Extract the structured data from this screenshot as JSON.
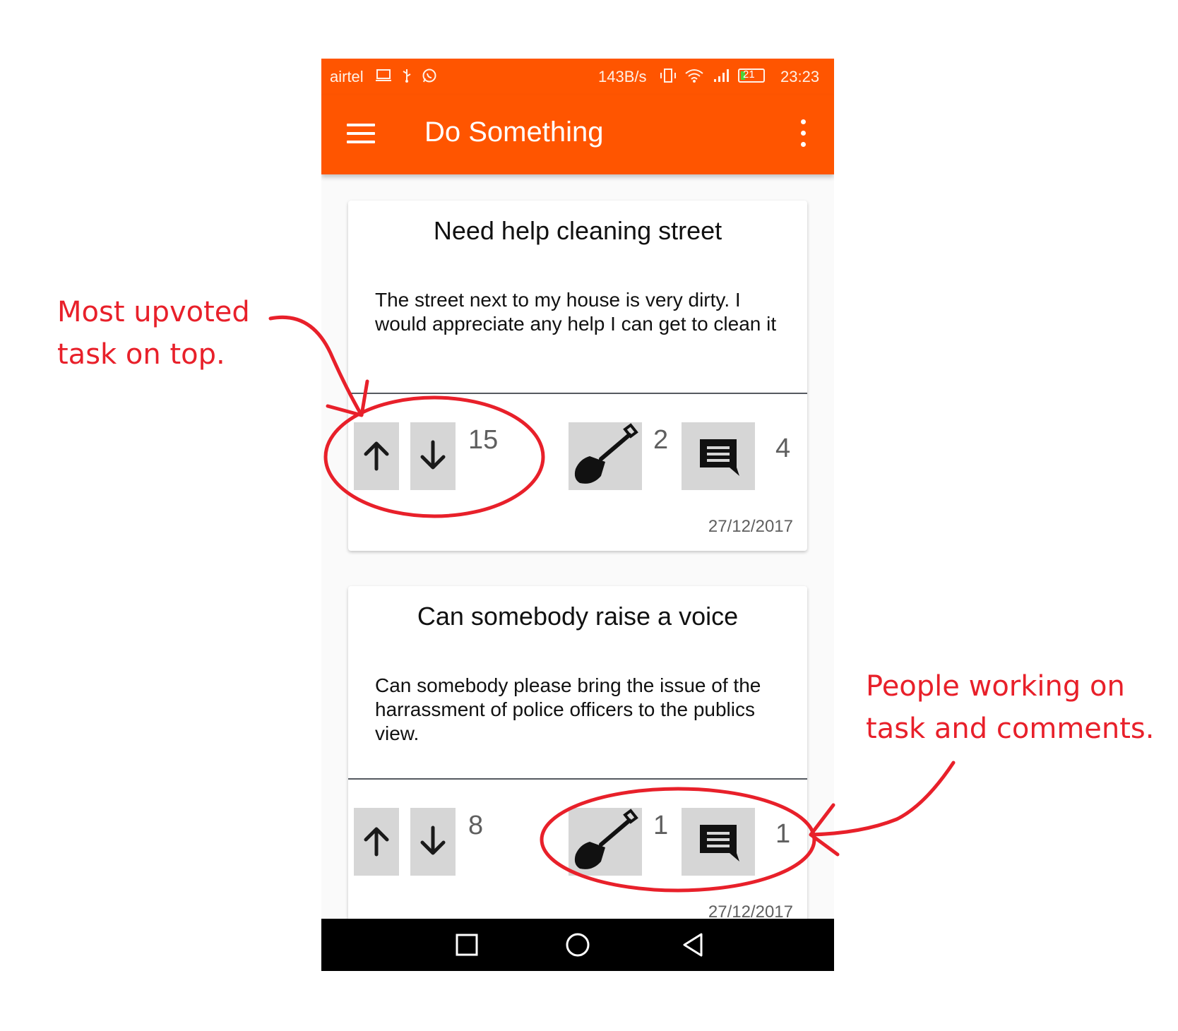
{
  "status_bar": {
    "carrier": "airtel",
    "left_icons": [
      "laptop-icon",
      "usb-icon",
      "whatsapp-icon"
    ],
    "speed": "143B/s",
    "right_icons": [
      "vibrate-icon",
      "wifi-icon",
      "signal-icon"
    ],
    "battery": 21,
    "battery_label": "21",
    "time": "23:23"
  },
  "app_bar": {
    "title": "Do Something",
    "left_icon": "menu-icon",
    "right_icon": "overflow-menu-icon"
  },
  "tasks": [
    {
      "title": "Need help cleaning street",
      "description": "The street next to my house is very dirty. I would appreciate any help I can get to clean it",
      "votes": "15",
      "workers": "2",
      "comments": "4",
      "date": "27/12/2017"
    },
    {
      "title": "Can somebody raise a voice",
      "description": "Can somebody please bring the issue of the harrassment of police officers to the publics view.",
      "votes": "8",
      "workers": "1",
      "comments": "1",
      "date": "27/12/2017"
    }
  ],
  "annotations": {
    "top_line1": "Most upvoted",
    "top_line2": "task on top.",
    "bottom_line1": "People working on",
    "bottom_line2": "task and comments."
  },
  "colors": {
    "primary": "#ff5500",
    "annotation": "#e8202a",
    "button_bg": "#d6d6d6"
  }
}
